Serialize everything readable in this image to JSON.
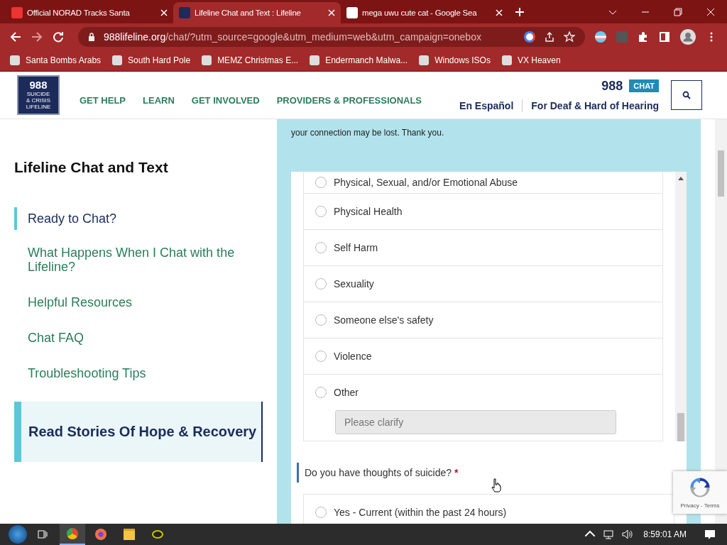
{
  "browser": {
    "tabs": [
      {
        "title": "Official NORAD Tracks Santa",
        "selected": false
      },
      {
        "title": "Lifeline Chat and Text : Lifeline",
        "selected": true
      },
      {
        "title": "mega uwu cute cat - Google Sea",
        "selected": false
      }
    ],
    "url_host": "988lifeline.org",
    "url_path": "/chat/?utm_source=google&utm_medium=web&utm_campaign=onebox",
    "bookmarks": [
      {
        "label": "Santa Bombs Arabs"
      },
      {
        "label": "South Hard Pole"
      },
      {
        "label": "MEMZ Christmas E..."
      },
      {
        "label": "Endermanch Malwa..."
      },
      {
        "label": "Windows ISOs"
      },
      {
        "label": "VX Heaven"
      }
    ]
  },
  "site": {
    "logo": {
      "number": "988",
      "lines": [
        "SUICIDE",
        "& CRISIS",
        "LIFELINE"
      ]
    },
    "nav": [
      "GET HELP",
      "LEARN",
      "GET INVOLVED",
      "PROVIDERS & PROFESSIONALS"
    ],
    "chat_number": "988",
    "chat_label": "CHAT",
    "links": [
      "En Español",
      "For Deaf & Hard of Hearing"
    ]
  },
  "sidebar": {
    "title": "Lifeline Chat and Text",
    "items": [
      {
        "label": "Ready to Chat?",
        "selected": true
      },
      {
        "label": "What Happens When I Chat with the Lifeline?",
        "selected": false
      },
      {
        "label": "Helpful Resources",
        "selected": false
      },
      {
        "label": "Chat FAQ",
        "selected": false
      },
      {
        "label": "Troubleshooting Tips",
        "selected": false
      }
    ],
    "story_link": "Read Stories Of Hope & Recovery"
  },
  "form": {
    "notice": "your connection may be lost. Thank you.",
    "options": [
      {
        "label": "Physical, Sexual, and/or Emotional Abuse",
        "selected": false
      },
      {
        "label": "Physical Health",
        "selected": false
      },
      {
        "label": "Self Harm",
        "selected": false
      },
      {
        "label": "Sexuality",
        "selected": false
      },
      {
        "label": "Someone else's safety",
        "selected": false
      },
      {
        "label": "Violence",
        "selected": false
      },
      {
        "label": "Other",
        "selected": false
      }
    ],
    "clarify_placeholder": "Please clarify",
    "question": "Do you have thoughts of suicide?",
    "required": "*",
    "answers": [
      {
        "label": "Yes - Current (within the past 24 hours)",
        "selected": false
      }
    ]
  },
  "recaptcha": "Privacy - Terms",
  "taskbar": {
    "time": "8:59:01 AM"
  }
}
